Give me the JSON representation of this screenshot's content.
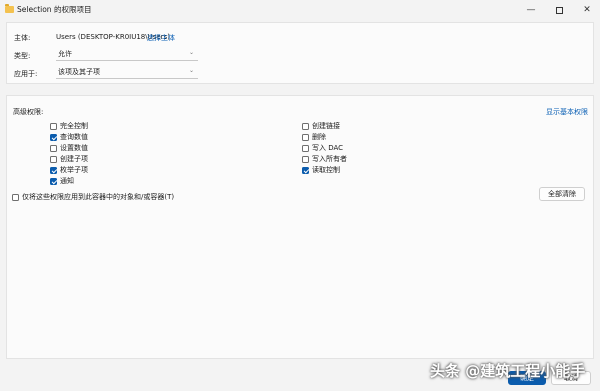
{
  "window": {
    "title": "Selection 的权限项目",
    "minimize_glyph": "—",
    "close_glyph": "✕"
  },
  "principal": {
    "label": "主体:",
    "value": "Users (DESKTOP-KR0IU18\\Users)",
    "select_link": "选择主体"
  },
  "type": {
    "label": "类型:",
    "value": "允许"
  },
  "applies_to": {
    "label": "应用于:",
    "value": "该项及其子项"
  },
  "advanced": {
    "label": "高级权限:",
    "show_basic_link": "显示基本权限",
    "left_permissions": [
      {
        "label": "完全控制",
        "checked": false
      },
      {
        "label": "查询数值",
        "checked": true
      },
      {
        "label": "设置数值",
        "checked": false
      },
      {
        "label": "创建子项",
        "checked": false
      },
      {
        "label": "枚举子项",
        "checked": true
      },
      {
        "label": "通知",
        "checked": true
      }
    ],
    "right_permissions": [
      {
        "label": "创建链接",
        "checked": false
      },
      {
        "label": "删除",
        "checked": false
      },
      {
        "label": "写入 DAC",
        "checked": false
      },
      {
        "label": "写入所有者",
        "checked": false
      },
      {
        "label": "读取控制",
        "checked": true
      }
    ],
    "only_apply_label": "仅将这些权限应用到此容器中的对象和/或容器(T)",
    "clear_all_label": "全部清除"
  },
  "footer": {
    "ok_label": "确定",
    "cancel_label": "取消"
  },
  "watermark": "头条 @建筑工程小能手",
  "colors": {
    "accent": "#0b5cad",
    "link": "#0a5fb4",
    "background": "#f3f3f3"
  },
  "icons": {
    "title": "folder-icon",
    "type_dropdown": "chevron-down-icon",
    "applies_dropdown": "chevron-down-icon"
  }
}
